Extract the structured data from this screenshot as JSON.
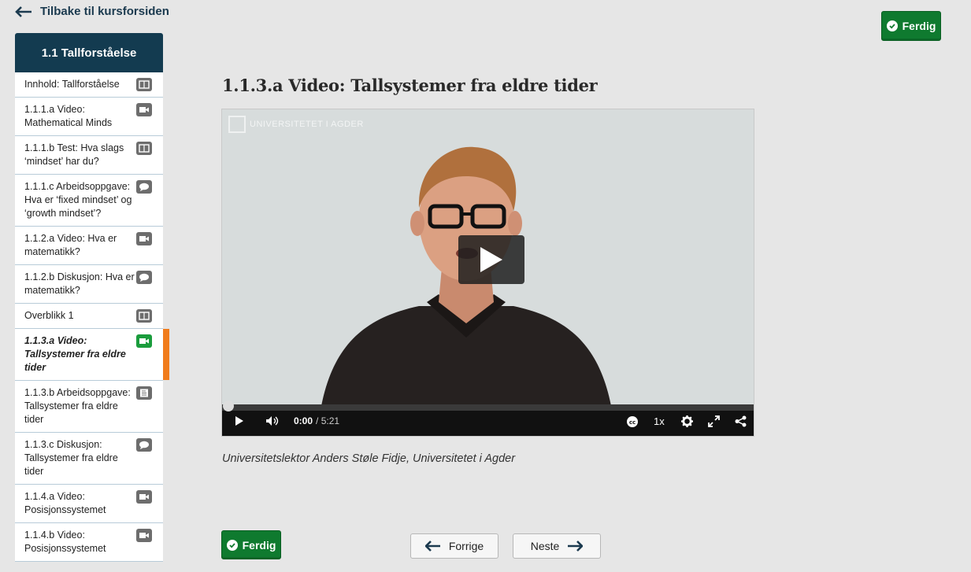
{
  "nav": {
    "back_label": "Tilbake til kursforsiden"
  },
  "ferdig_label": "Ferdig",
  "sidebar": {
    "title": "1.1 Tallforståelse",
    "items": [
      {
        "label": "Innhold: Tallforståelse",
        "icon": "book-icon"
      },
      {
        "label": "1.1.1.a Video: Mathematical Minds",
        "icon": "video-camera-icon"
      },
      {
        "label": "1.1.1.b Test: Hva slags ‘mindset’ har du?",
        "icon": "book-icon"
      },
      {
        "label": "1.1.1.c Arbeidsoppgave: Hva er ‘fixed mindset’ og ‘growth mindset’?",
        "icon": "chat-bubble-icon"
      },
      {
        "label": "1.1.2.a Video: Hva er matematikk?",
        "icon": "video-camera-icon"
      },
      {
        "label": "1.1.2.b Diskusjon: Hva er matematikk?",
        "icon": "chat-bubble-icon"
      },
      {
        "label": "Overblikk 1",
        "icon": "book-icon"
      },
      {
        "label": "1.1.3.a Video: Tallsystemer fra eldre tider",
        "icon": "video-camera-icon",
        "active": true
      },
      {
        "label": "1.1.3.b Arbeidsoppgave: Tallsystemer fra eldre tider",
        "icon": "document-icon"
      },
      {
        "label": "1.1.3.c Diskusjon: Tallsystemer fra eldre tider",
        "icon": "chat-bubble-icon"
      },
      {
        "label": "1.1.4.a Video: Posisjonssystemet",
        "icon": "video-camera-icon"
      },
      {
        "label": "1.1.4.b Video: Posisjonssystemet",
        "icon": "video-camera-icon"
      }
    ]
  },
  "main": {
    "title": "1.1.3.a Video: Tallsystemer fra eldre tider",
    "video": {
      "watermark": "UNIVERSITETET I AGDER",
      "current_time": "0:00",
      "duration": "/ 5:21",
      "speed": "1x",
      "progress": 0
    },
    "caption": "Universitetslektor Anders Støle Fidje, Universitetet i Agder"
  },
  "pager": {
    "prev_label": "Forrige",
    "next_label": "Neste"
  },
  "colors": {
    "accent_green": "#0f7a2f",
    "sidebar_header": "#133b50",
    "active_marker": "#f07c1c"
  }
}
